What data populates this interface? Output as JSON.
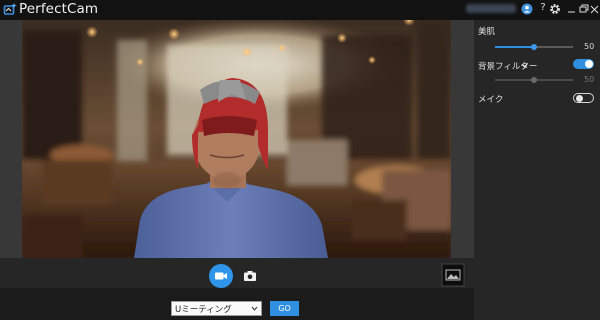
{
  "app": {
    "title": "PerfectCam"
  },
  "titlebar": {
    "user_name": "",
    "icons": [
      "user-badge-icon",
      "help-icon",
      "settings-icon",
      "minimize-icon",
      "restore-icon",
      "close-icon"
    ],
    "help_glyph": "?"
  },
  "video": {
    "description_icons": [
      "camera-preview"
    ]
  },
  "controls": {
    "video_mode_icon": "video-camera-icon",
    "photo_mode_icon": "camera-icon",
    "gallery_icon": "gallery-icon"
  },
  "bottom": {
    "meeting_select_value": "Uミーティング",
    "go_label": "GO"
  },
  "panel": {
    "skin": {
      "label": "美肌",
      "value_text": "50",
      "value": 50,
      "max": 100
    },
    "background_filter": {
      "label": "背景フィルター",
      "value_text": "50",
      "value": 50,
      "max": 100,
      "enabled": true
    },
    "makeup": {
      "label": "メイク",
      "enabled": false
    }
  },
  "colors": {
    "accent": "#2f8fe0",
    "panel_bg": "#262626",
    "title_bg": "#121212"
  }
}
